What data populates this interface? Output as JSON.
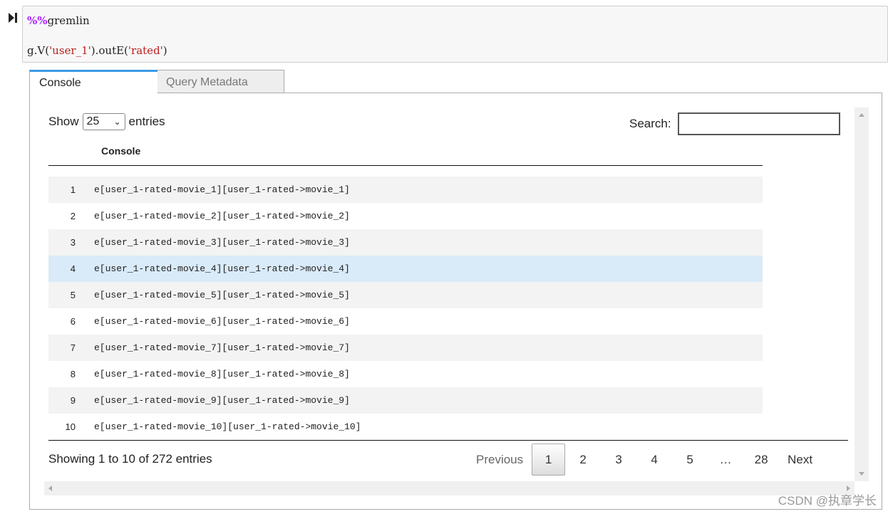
{
  "cell": {
    "magic_prefix": "%%",
    "magic_name": "gremlin",
    "code_prefix": "g.V(",
    "arg1": "'user_1'",
    "code_mid": ").outE(",
    "arg2": "'rated'",
    "code_end": ")"
  },
  "tabs": [
    {
      "label": "Console",
      "active": true
    },
    {
      "label": "Query Metadata",
      "active": false
    }
  ],
  "length": {
    "show": "Show",
    "value": "25",
    "entries": "entries"
  },
  "search": {
    "label": "Search:",
    "value": ""
  },
  "table": {
    "header": "Console",
    "highlighted_row": 4,
    "rows": [
      {
        "n": "1",
        "v": "e[user_1-rated-movie_1][user_1-rated->movie_1]"
      },
      {
        "n": "2",
        "v": "e[user_1-rated-movie_2][user_1-rated->movie_2]"
      },
      {
        "n": "3",
        "v": "e[user_1-rated-movie_3][user_1-rated->movie_3]"
      },
      {
        "n": "4",
        "v": "e[user_1-rated-movie_4][user_1-rated->movie_4]"
      },
      {
        "n": "5",
        "v": "e[user_1-rated-movie_5][user_1-rated->movie_5]"
      },
      {
        "n": "6",
        "v": "e[user_1-rated-movie_6][user_1-rated->movie_6]"
      },
      {
        "n": "7",
        "v": "e[user_1-rated-movie_7][user_1-rated->movie_7]"
      },
      {
        "n": "8",
        "v": "e[user_1-rated-movie_8][user_1-rated->movie_8]"
      },
      {
        "n": "9",
        "v": "e[user_1-rated-movie_9][user_1-rated->movie_9]"
      },
      {
        "n": "10",
        "v": "e[user_1-rated-movie_10][user_1-rated->movie_10]"
      }
    ]
  },
  "info": "Showing 1 to 10 of 272 entries",
  "pager": {
    "previous": "Previous",
    "pages": [
      "1",
      "2",
      "3",
      "4",
      "5",
      "…",
      "28"
    ],
    "current": "1",
    "next": "Next"
  },
  "watermark": "CSDN @执章学长",
  "colors": {
    "accent": "#3a9be6",
    "highlight": "#d9eaf8",
    "magic": "#aa22ff",
    "string": "#ba2121"
  }
}
